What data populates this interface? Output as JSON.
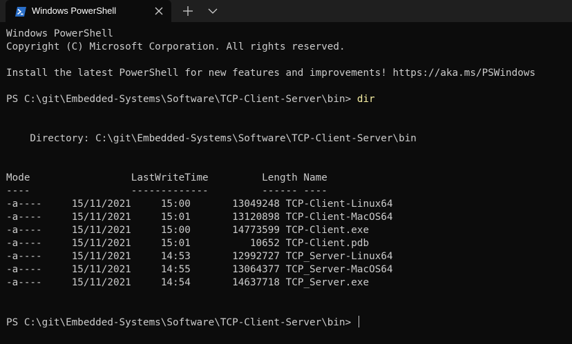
{
  "window": {
    "tab_title": "Windows PowerShell",
    "tab_icon": "powershell-icon",
    "close_icon": "close-icon",
    "new_tab_icon": "plus-icon",
    "dropdown_icon": "chevron-down-icon"
  },
  "colors": {
    "background": "#0c0c0c",
    "titlebar": "#1f1f1f",
    "text": "#cccccc",
    "command": "#f9f1a5"
  },
  "terminal": {
    "banner_line1": "Windows PowerShell",
    "banner_line2": "Copyright (C) Microsoft Corporation. All rights reserved.",
    "banner_line3": "Install the latest PowerShell for new features and improvements! https://aka.ms/PSWindows",
    "prompt": "PS C:\\git\\Embedded-Systems\\Software\\TCP-Client-Server\\bin> ",
    "command": "dir",
    "directory_line": "    Directory: C:\\git\\Embedded-Systems\\Software\\TCP-Client-Server\\bin",
    "header_line": "Mode                 LastWriteTime         Length Name",
    "separator_line": "----                 -------------         ------ ----",
    "rows": [
      {
        "mode": "-a----",
        "date": "15/11/2021",
        "time": "15:00",
        "length": "13049248",
        "name": "TCP-Client-Linux64"
      },
      {
        "mode": "-a----",
        "date": "15/11/2021",
        "time": "15:01",
        "length": "13120898",
        "name": "TCP-Client-MacOS64"
      },
      {
        "mode": "-a----",
        "date": "15/11/2021",
        "time": "15:00",
        "length": "14773599",
        "name": "TCP-Client.exe"
      },
      {
        "mode": "-a----",
        "date": "15/11/2021",
        "time": "15:01",
        "length": "10652",
        "name": "TCP-Client.pdb"
      },
      {
        "mode": "-a----",
        "date": "15/11/2021",
        "time": "14:53",
        "length": "12992727",
        "name": "TCP_Server-Linux64"
      },
      {
        "mode": "-a----",
        "date": "15/11/2021",
        "time": "14:55",
        "length": "13064377",
        "name": "TCP_Server-MacOS64"
      },
      {
        "mode": "-a----",
        "date": "15/11/2021",
        "time": "14:54",
        "length": "14637718",
        "name": "TCP_Server.exe"
      }
    ],
    "final_prompt": "PS C:\\git\\Embedded-Systems\\Software\\TCP-Client-Server\\bin> "
  }
}
